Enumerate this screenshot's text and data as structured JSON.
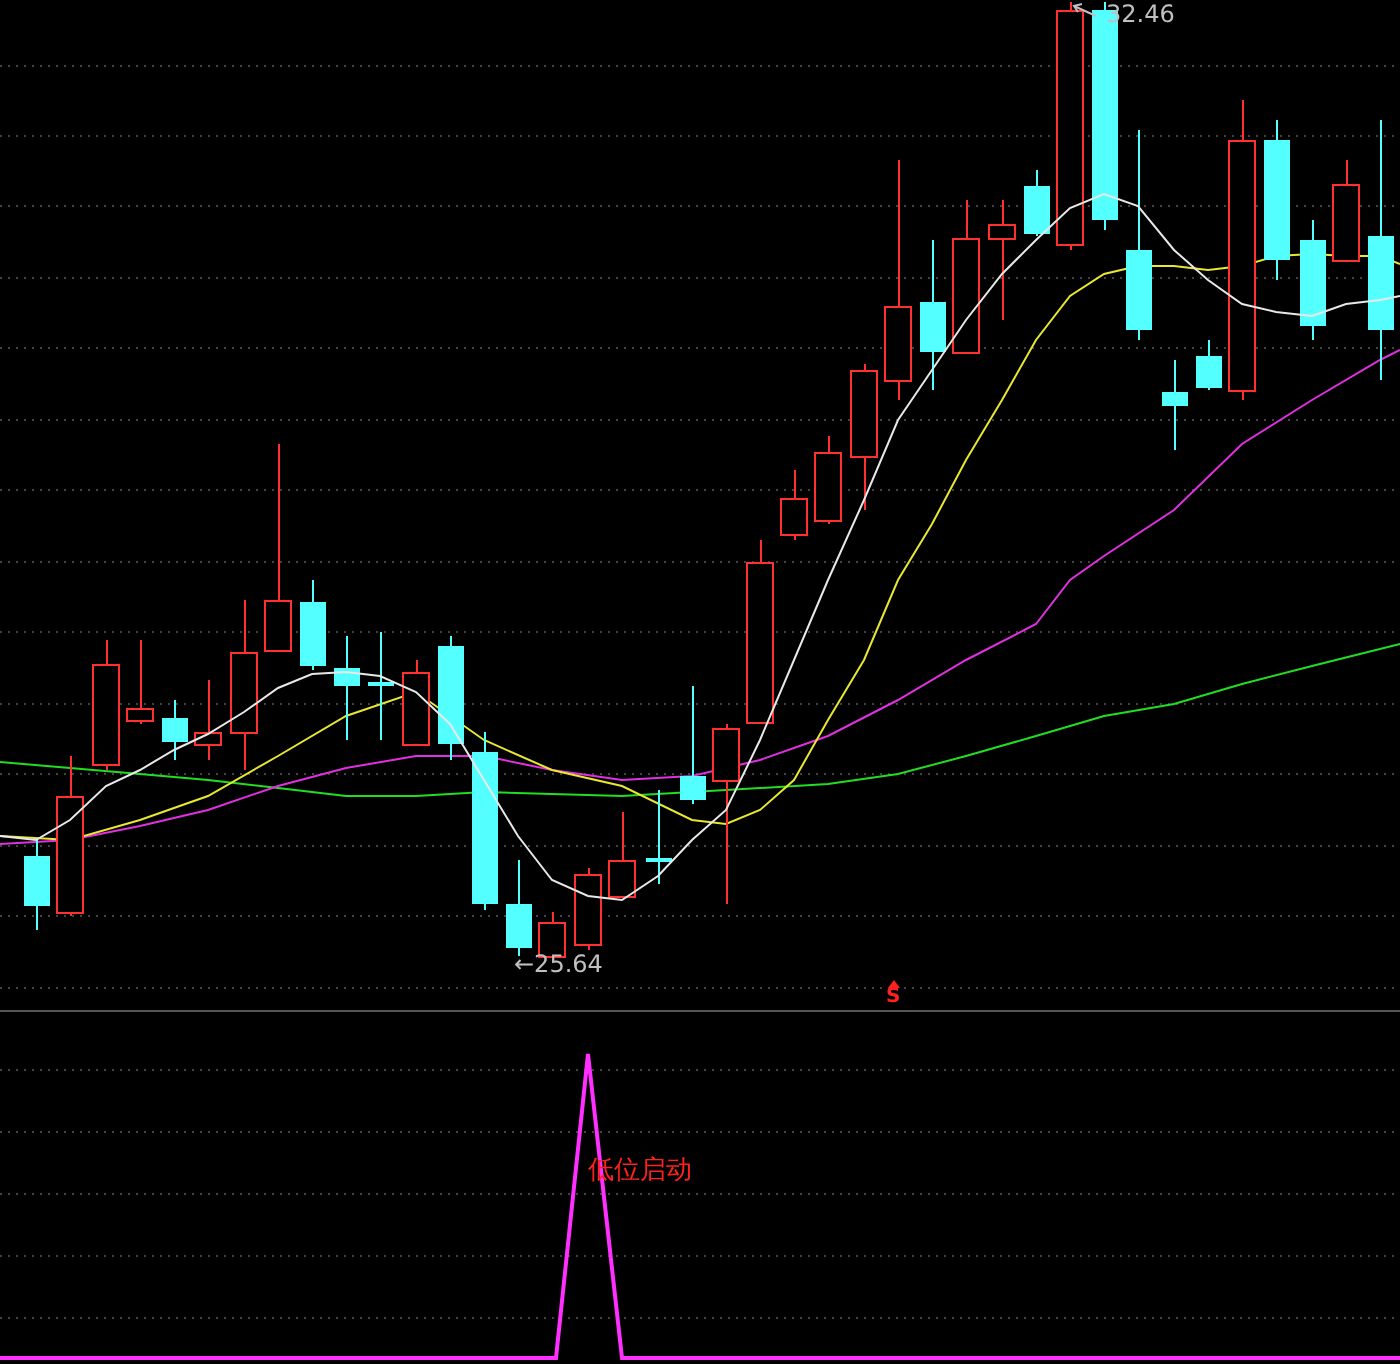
{
  "price_chart": {
    "high_label": "32.46",
    "low_label": "←25.64",
    "signal_mark": "S"
  },
  "indicator_panel": {
    "signal_label": "低位启动"
  }
}
